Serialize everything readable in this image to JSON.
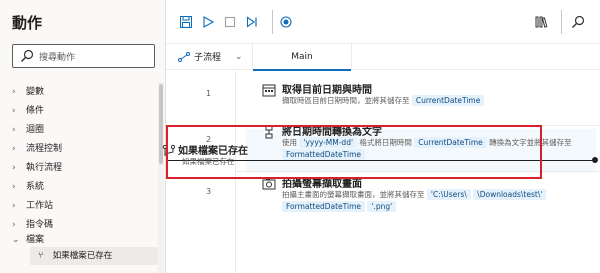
{
  "left_pane": {
    "title": "動作",
    "search_placeholder": "搜尋動作",
    "categories": [
      {
        "chevron": "›",
        "label": "變數"
      },
      {
        "chevron": "›",
        "label": "條件"
      },
      {
        "chevron": "›",
        "label": "迴圈"
      },
      {
        "chevron": "›",
        "label": "流程控制"
      },
      {
        "chevron": "›",
        "label": "執行流程"
      },
      {
        "chevron": "›",
        "label": "系統"
      },
      {
        "chevron": "›",
        "label": "工作站"
      },
      {
        "chevron": "›",
        "label": "指令碼"
      },
      {
        "chevron": "⌄",
        "label": "檔案"
      }
    ],
    "sub_item": "如果檔案已存在",
    "sub_item_icon": "if-file-icon"
  },
  "toolbar": {
    "icons": [
      "save-icon",
      "run-icon",
      "stop-icon",
      "run-next-icon",
      "record-icon",
      "library-icon",
      "search-icon"
    ],
    "accent": "#0f6cbd"
  },
  "tabs": {
    "subflow_label": "子流程",
    "subflow_chevron": "⌄",
    "main_label": "Main"
  },
  "flow": {
    "actions": [
      {
        "number": "1",
        "title": "取得目前日期與時間",
        "desc_pre": "擷取時區目前日期時間，並將其儲存至",
        "chips": [
          "CurrentDateTime"
        ],
        "icon": "calendar-icon"
      },
      {
        "number": "2",
        "title": "將日期時間轉換為文字",
        "desc_pre": "使用",
        "fmt_chip": "'yyyy-MM-dd'",
        "desc_mid": "格式將日期時間",
        "chip_a": "CurrentDateTime",
        "desc_post": "轉換為文字並將其儲存至",
        "chip_b": "FormattedDateTime",
        "icon": "text-convert-icon"
      },
      {
        "number": "3",
        "title": "拍攝螢幕擷取畫面",
        "desc_pre": "拍攝主畫面的螢幕擷取畫面，並將其儲存至",
        "path_a": "'C:\\Users\\",
        "path_b": "\\Downloads\\test\\'",
        "chip": "FormattedDateTime",
        "path_c": "'.png'",
        "icon": "screenshot-icon"
      }
    ],
    "drag_title": "如果檔案已存在",
    "drag_sub": "如果檔案已存在",
    "highlight_color": "#d9202b"
  }
}
